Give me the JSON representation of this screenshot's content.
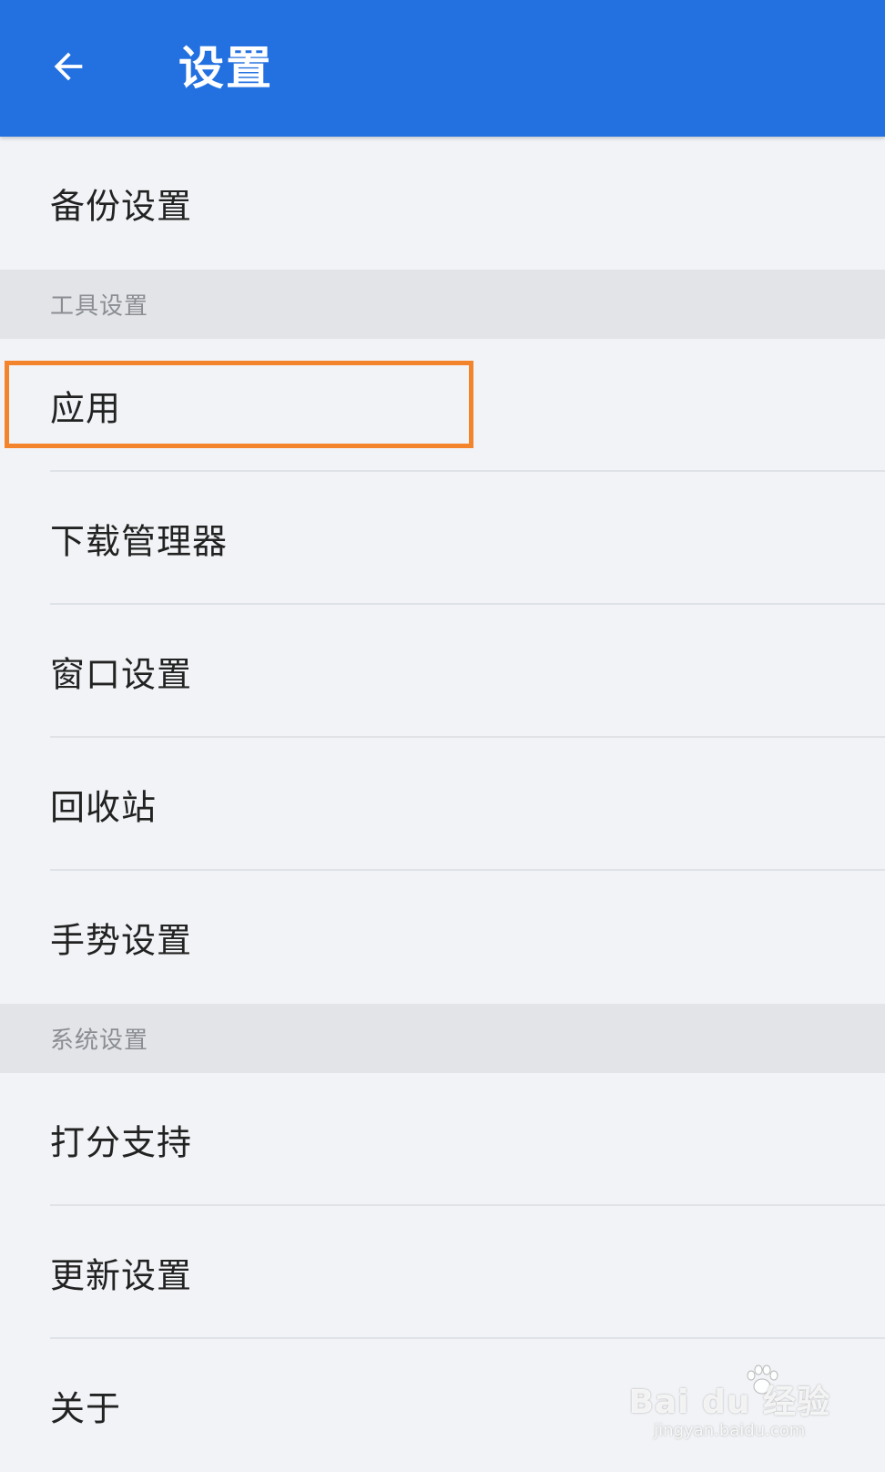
{
  "app_bar": {
    "title": "设置",
    "back_icon": "arrow-left-icon"
  },
  "list": {
    "backup_settings": "备份设置",
    "section_tools": "工具设置",
    "apps": "应用",
    "download_manager": "下载管理器",
    "window_settings": "窗口设置",
    "recycle_bin": "回收站",
    "gesture_settings": "手势设置",
    "section_system": "系统设置",
    "rate_support": "打分支持",
    "update_settings": "更新设置",
    "about": "关于"
  },
  "watermark": {
    "main": "Bai du 经验",
    "sub": "jingyan.baidu.com"
  },
  "colors": {
    "app_bar": "#2370e0",
    "background": "#f1f3f6",
    "section_header": "#e2e4e8",
    "highlight": "#f4842c"
  }
}
